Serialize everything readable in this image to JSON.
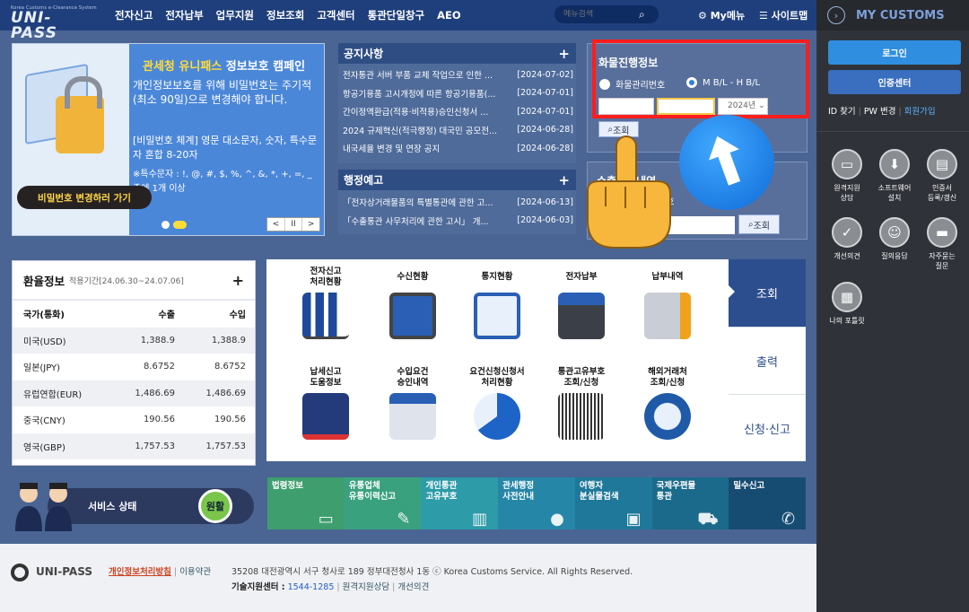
{
  "header": {
    "logo_small": "Korea Customs e-Clearance System",
    "logo_main": "UNI-PASS",
    "menu": [
      "전자신고",
      "전자납부",
      "업무지원",
      "정보조회",
      "고객센터",
      "통관단일창구",
      "AEO"
    ],
    "search_placeholder": "메뉴검색",
    "my_menu": "My메뉴",
    "sitemap": "사이트맵"
  },
  "banner": {
    "title_hl": "관세청 유니패스",
    "title_rest": "정보보호 캠페인",
    "body1": "개인정보보호를 위해 비밀번호는 주기적(최소 90일)으로 변경해야 합니다.",
    "body2": "[비밀번호 체계] 영문 대소문자, 숫자, 특수문자 혼합 8-20자",
    "body3": "※특수문자 : !, @, #, $, %, ^, &, *, +, =, _ 중에 1개 이상",
    "cta": "비밀번호 변경하러 가기",
    "controls": [
      "<",
      "II",
      ">"
    ]
  },
  "notice": {
    "title": "공지사항",
    "plus": "+",
    "rows": [
      {
        "title": "전자통관 서버 부품 교체 작업으로 인한 ...",
        "date": "[2024-07-02]"
      },
      {
        "title": "항공기용품 고시개정에 따른 항공기용품(...",
        "date": "[2024-07-01]"
      },
      {
        "title": "간이정액환급(적용·비적용)승인신청서 ...",
        "date": "[2024-07-01]"
      },
      {
        "title": "2024 규제혁신(적극행정) 대국민 공모전...",
        "date": "[2024-06-28]"
      },
      {
        "title": "내국세율 변경 및 연장 공지",
        "date": "[2024-06-28]"
      }
    ]
  },
  "admin": {
    "title": "행정예고",
    "plus": "+",
    "rows": [
      {
        "title": "「전자상거래물품의 특별통관에 관한 고...",
        "date": "[2024-06-13]"
      },
      {
        "title": "「수출통관 사무처리에 관한 고시」 개...",
        "date": "[2024-06-03]"
      }
    ]
  },
  "cargo": {
    "title": "화물진행정보",
    "radio1": "화물관리번호",
    "radio2": "M B/L - H B/L",
    "year": "2024년",
    "button": "조회"
  },
  "export": {
    "title": "수출이행내역",
    "label": "번호",
    "button": "조회"
  },
  "exchange": {
    "title": "환율정보",
    "period": "적용기간[24.06.30~24.07.06]",
    "plus": "+",
    "headers": [
      "국가(통화)",
      "수출",
      "수입"
    ],
    "rows": [
      {
        "name": "미국(USD)",
        "export": "1,388.9",
        "import": "1,388.9"
      },
      {
        "name": "일본(JPY)",
        "export": "8.6752",
        "import": "8.6752"
      },
      {
        "name": "유럽연합(EUR)",
        "export": "1,486.69",
        "import": "1,486.69"
      },
      {
        "name": "중국(CNY)",
        "export": "190.56",
        "import": "190.56"
      },
      {
        "name": "영국(GBP)",
        "export": "1,757.53",
        "import": "1,757.53"
      }
    ]
  },
  "services": [
    {
      "label": "전자신고\n처리현황"
    },
    {
      "label": "수신현황"
    },
    {
      "label": "통지현황"
    },
    {
      "label": "전자납부"
    },
    {
      "label": "납부내역"
    },
    {
      "label": "납세신고\n도움정보"
    },
    {
      "label": "수입요건\n승인내역"
    },
    {
      "label": "요건신청신청서\n처리현황"
    },
    {
      "label": "통관고유부호\n조회/신청"
    },
    {
      "label": "해외거래처\n조회/신청"
    }
  ],
  "side_tabs": [
    "조회",
    "출력",
    "신청·신고"
  ],
  "status": {
    "label": "서비스 상태",
    "value": "원활"
  },
  "tiles": [
    {
      "label": "법령정보",
      "color": "#3e9e6e"
    },
    {
      "label": "유통업체\n유통이력신고",
      "color": "#3aa17f"
    },
    {
      "label": "개인통관\n고유부호",
      "color": "#2d9ba8"
    },
    {
      "label": "관세행정\n사전안내",
      "color": "#2686a8"
    },
    {
      "label": "여행자\n분실물검색",
      "color": "#1f7899"
    },
    {
      "label": "국제우편물\n통관",
      "color": "#1b6a8b"
    },
    {
      "label": "밀수신고",
      "color": "#174c72"
    }
  ],
  "footer": {
    "brand": "UNI-PASS",
    "privacy": "개인정보처리방침",
    "terms": "이용약관",
    "address": "35208 대전광역시 서구 청사로 189 정부대전청사 1동 ⓒ Korea Customs Service. All Rights Reserved.",
    "center_label": "기술지원센터 :",
    "center_phone": "1544-1285",
    "remote": "원격지원상담",
    "opinion": "개선의견"
  },
  "right_panel": {
    "title": "MY CUSTOMS",
    "login": "로그인",
    "cert": "인증센터",
    "id_find": "ID 찾기",
    "pw_change": "PW 변경",
    "join": "회원가입",
    "icons": [
      {
        "label": "원격지원\n상담"
      },
      {
        "label": "소프트웨어\n설치"
      },
      {
        "label": "인증서\n등록/갱신"
      },
      {
        "label": "개선의견"
      },
      {
        "label": "질의응답"
      },
      {
        "label": "자주묻는\n질문"
      },
      {
        "label": "나의 포틀릿"
      }
    ]
  }
}
